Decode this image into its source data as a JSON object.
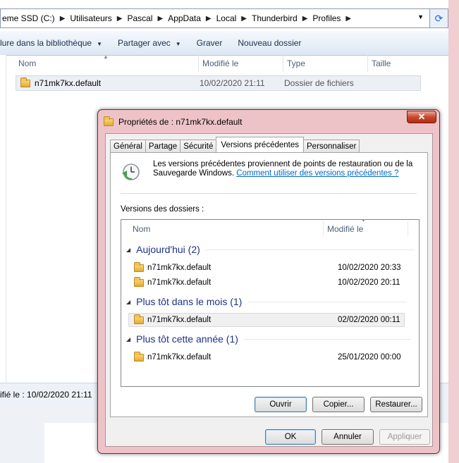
{
  "explorer": {
    "breadcrumb": [
      "eme SSD (C:)",
      "Utilisateurs",
      "Pascal",
      "AppData",
      "Local",
      "Thunderbird",
      "Profiles"
    ],
    "toolbar": [
      "lure dans la bibliothèque",
      "Partager avec",
      "Graver",
      "Nouveau dossier"
    ],
    "columns": {
      "name": "Nom",
      "modified": "Modifié le",
      "type": "Type",
      "size": "Taille"
    },
    "file": {
      "name": "n71mk7kx.default",
      "modified": "10/02/2020 21:11",
      "type": "Dossier de fichiers"
    },
    "status_text": "ifié le : 10/02/2020 21:11"
  },
  "dialog": {
    "title": "Propriétés de : n71mk7kx.default",
    "close_label": "✕",
    "tabs": [
      "Général",
      "Partage",
      "Sécurité",
      "Versions précédentes",
      "Personnaliser"
    ],
    "active_tab": "Versions précédentes",
    "info_text": "Les versions précédentes proviennent de points de restauration ou de la Sauvegarde Windows.",
    "info_link": "Comment utiliser des versions précédentes ?",
    "versions_label": "Versions des dossiers :",
    "list_columns": {
      "name": "Nom",
      "modified": "Modifié le"
    },
    "groups": [
      {
        "label": "Aujourd'hui (2)",
        "items": [
          {
            "name": "n71mk7kx.default",
            "date": "10/02/2020 20:33"
          },
          {
            "name": "n71mk7kx.default",
            "date": "10/02/2020 20:11"
          }
        ]
      },
      {
        "label": "Plus tôt dans le mois (1)",
        "items": [
          {
            "name": "n71mk7kx.default",
            "date": "02/02/2020 00:11"
          }
        ]
      },
      {
        "label": "Plus tôt cette année (1)",
        "items": [
          {
            "name": "n71mk7kx.default",
            "date": "25/01/2020 00:00"
          }
        ]
      }
    ],
    "buttons": {
      "open": "Ouvrir",
      "copy": "Copier...",
      "restore": "Restaurer...",
      "ok": "OK",
      "cancel": "Annuler",
      "apply": "Appliquer"
    }
  }
}
